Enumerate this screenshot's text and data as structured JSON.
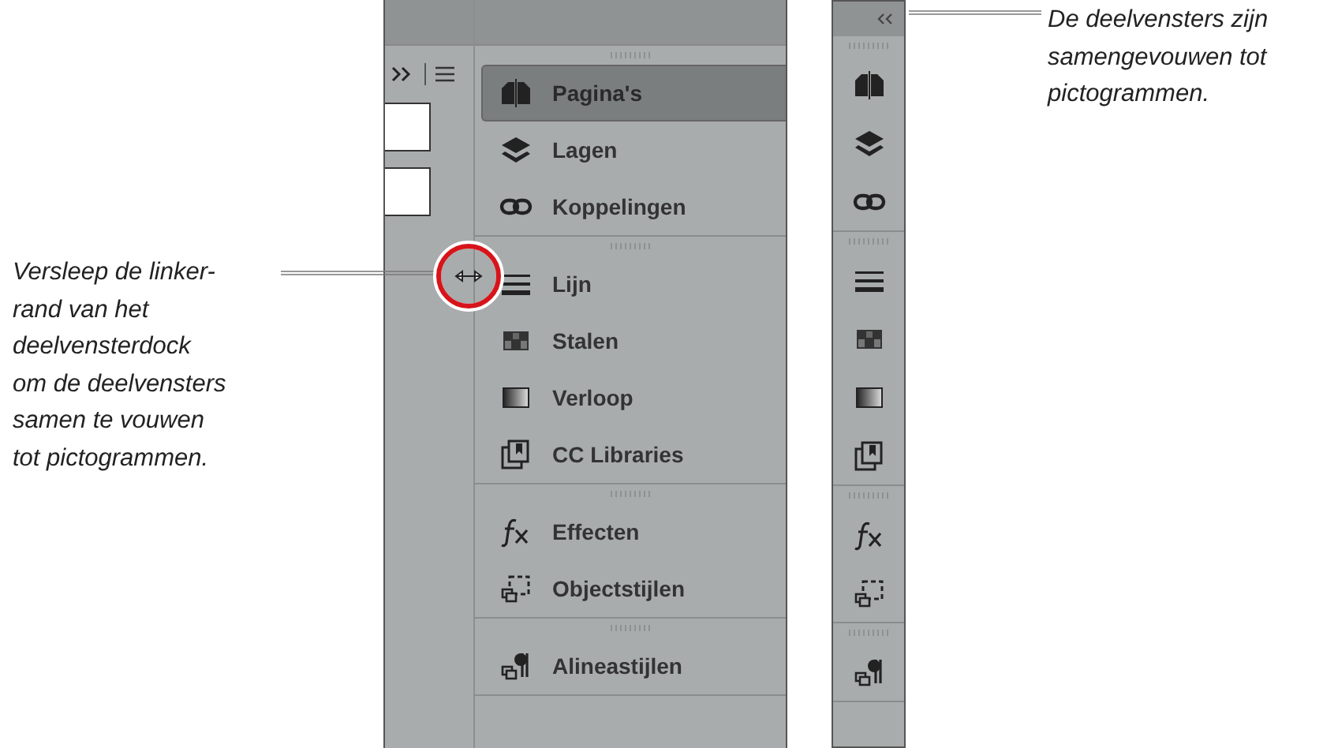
{
  "annotation_left": {
    "lines": [
      "Versleep de linker-",
      "rand van het",
      "deelvensterdock",
      "om de deelvensters",
      "samen te vouwen",
      "tot pictogrammen."
    ]
  },
  "annotation_right": {
    "lines": [
      "De deelvensters zijn",
      "samengevouwen tot",
      "pictogrammen."
    ]
  },
  "dock": {
    "groups": [
      {
        "items": [
          {
            "label": "Pagina's",
            "selected": true
          },
          {
            "label": "Lagen",
            "selected": false
          },
          {
            "label": "Koppelingen",
            "selected": false
          }
        ]
      },
      {
        "items": [
          {
            "label": "Lijn",
            "selected": false
          },
          {
            "label": "Stalen",
            "selected": false
          },
          {
            "label": "Verloop",
            "selected": false
          },
          {
            "label": "CC Libraries",
            "selected": false
          }
        ]
      },
      {
        "items": [
          {
            "label": "Effecten",
            "selected": false
          },
          {
            "label": "Objectstijlen",
            "selected": false
          }
        ]
      },
      {
        "items": [
          {
            "label": "Alineastijlen",
            "selected": false
          }
        ]
      }
    ]
  }
}
